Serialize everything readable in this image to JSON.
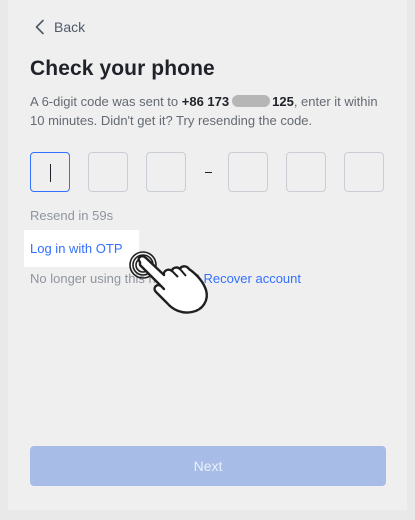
{
  "header": {
    "back_label": "Back",
    "back_icon": "chevron-left-icon"
  },
  "main": {
    "title": "Check your phone",
    "description": {
      "prefix": "A 6-digit code was sent to ",
      "phone_start": "+86 173",
      "phone_end": "125",
      "suffix": ", enter it within 10 minutes. Didn't get it? Try resending the code."
    },
    "otp": {
      "length": 6,
      "values": [
        "",
        "",
        "",
        "",
        "",
        ""
      ]
    },
    "resend_text": "Resend in 59s",
    "otp_login_link": "Log in with OTP",
    "recover_prompt": "No longer using this number?",
    "recover_link": "Recover account",
    "next_button": "Next"
  },
  "colors": {
    "accent": "#3370ff",
    "button_disabled": "#a7bde7",
    "text_muted": "#8f959e"
  },
  "overlay": {
    "cursor_icon": "hand-pointer-icon"
  }
}
